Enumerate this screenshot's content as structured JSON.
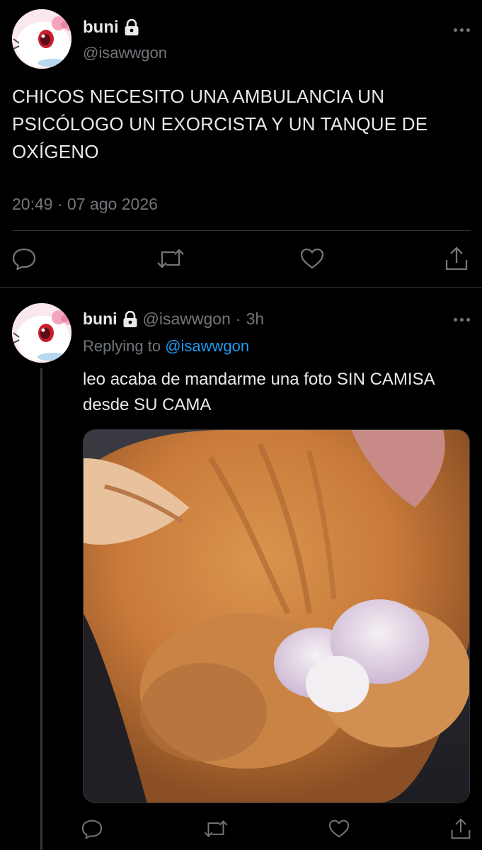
{
  "main_tweet": {
    "display_name": "buni",
    "handle": "@isawwgon",
    "text": "CHICOS NECESITO UNA AMBULANCIA UN PSICÓLOGO UN EXORCISTA Y UN TANQUE DE OXÍGENO",
    "timestamp": "20:49 · 07 ago 2026",
    "actions": [
      "reply-icon",
      "retweet-icon",
      "like-icon",
      "share-icon"
    ]
  },
  "reply_tweet": {
    "display_name": "buni",
    "handle": "@isawwgon",
    "separator": "·",
    "time": "3h",
    "replying_prefix": "Replying to",
    "replying_to": "@isawwgon",
    "text": "leo acaba de mandarme una foto SIN CAMISA desde SU CAMA",
    "media_icon": "cat-covering-face-photo",
    "actions": [
      "reply-icon",
      "retweet-icon",
      "like-icon",
      "share-icon"
    ]
  },
  "colors": {
    "background": "#000000",
    "primary_text": "#e7e9ea",
    "secondary_text": "#71767b",
    "link": "#1d9bf0",
    "divider": "#2f3336"
  }
}
